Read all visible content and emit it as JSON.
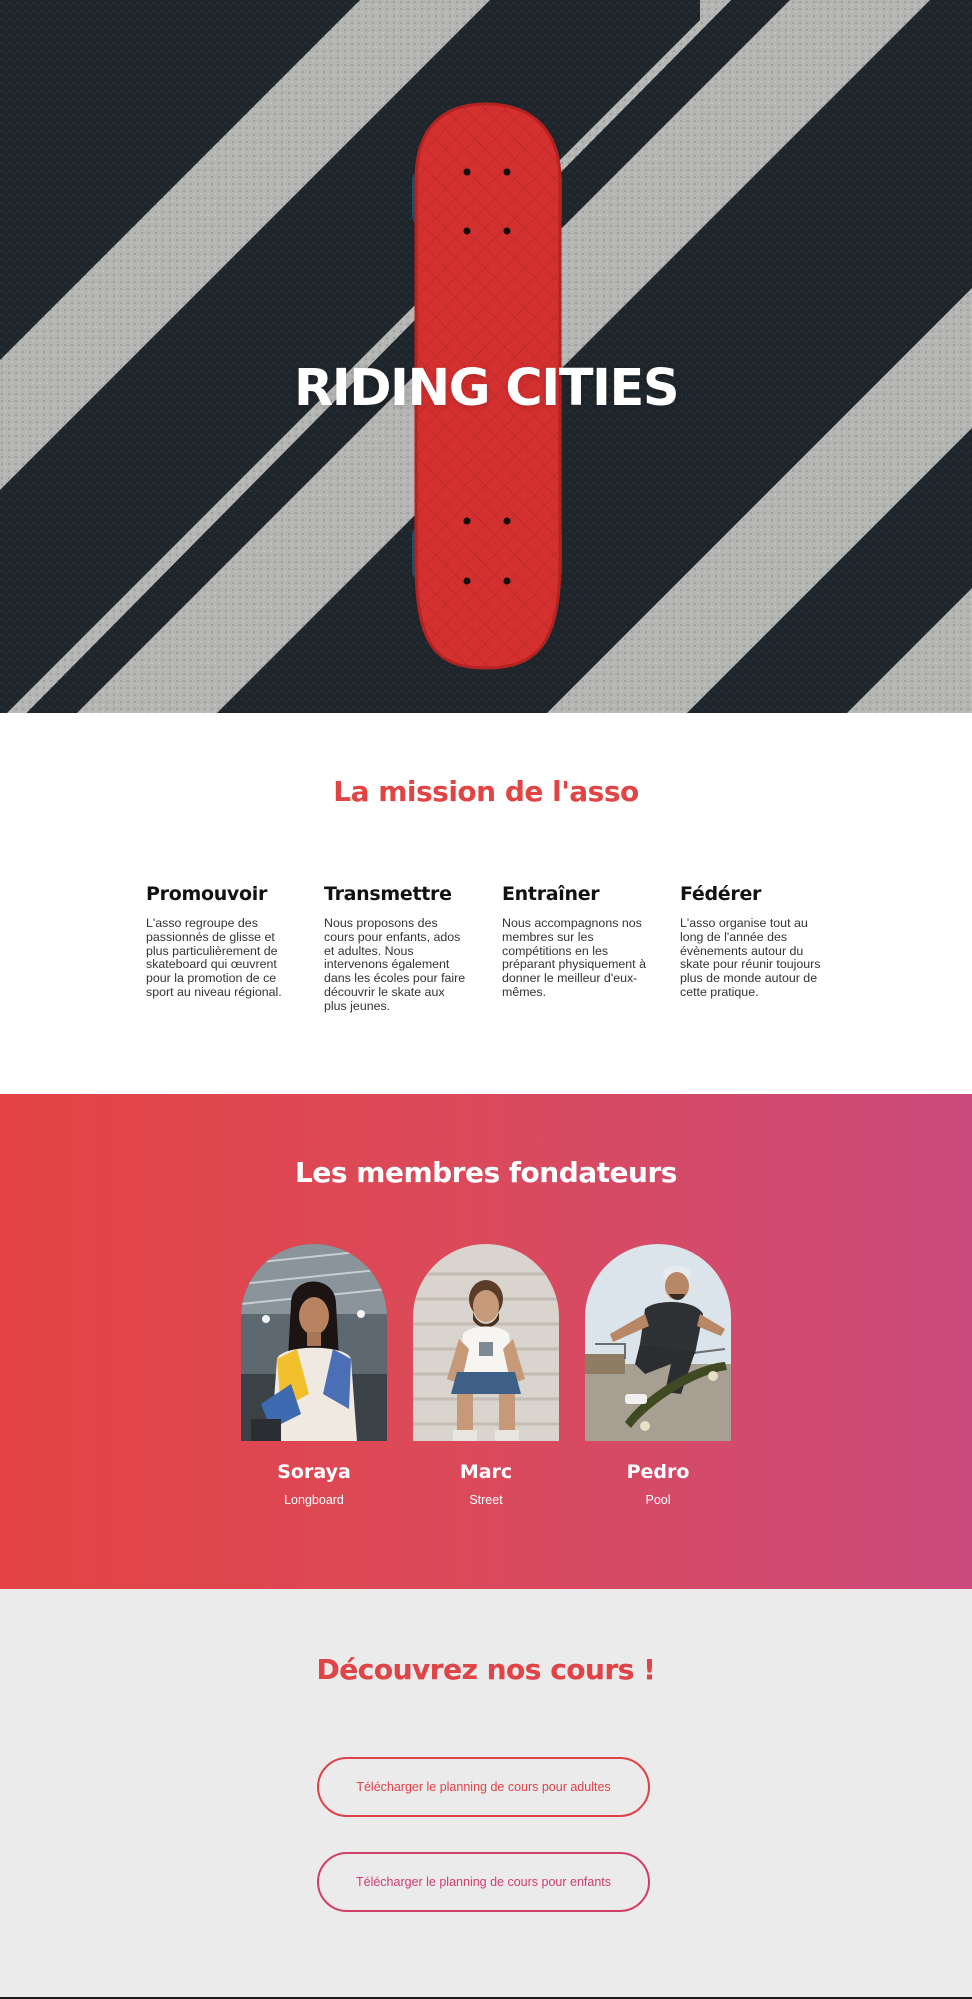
{
  "hero": {
    "title": "RIDING CITIES"
  },
  "mission": {
    "title": "La mission de l'asso",
    "pillars": [
      {
        "title": "Promouvoir",
        "text": "L'asso regroupe des passionnés de glisse et plus particulièrement de skateboard qui œuvrent pour la promotion de ce sport au niveau régional."
      },
      {
        "title": "Transmettre",
        "text": "Nous proposons des cours pour enfants, ados et adultes. Nous intervenons également dans les écoles pour faire découvrir le skate aux plus jeunes."
      },
      {
        "title": "Entraîner",
        "text": "Nous accompagnons nos membres sur les compétitions en les préparant physiquement à donner le meilleur d'eux-mêmes."
      },
      {
        "title": "Fédérer",
        "text": "L'asso organise tout au long de l'année des évènements autour du skate pour réunir toujours plus de monde autour de cette pratique."
      }
    ]
  },
  "members": {
    "title": "Les membres fondateurs",
    "list": [
      {
        "name": "Soraya",
        "discipline": "Longboard"
      },
      {
        "name": "Marc",
        "discipline": "Street"
      },
      {
        "name": "Pedro",
        "discipline": "Pool"
      }
    ]
  },
  "courses": {
    "title": "Découvrez nos cours !",
    "buttons": {
      "adults": "Télécharger le planning de cours pour adultes",
      "kids": "Télécharger le planning de cours pour enfants"
    }
  },
  "colors": {
    "accent": "#e14444",
    "gradient_start": "#e34343",
    "gradient_end": "#cb4a7c",
    "courses_bg": "#ebebeb"
  }
}
